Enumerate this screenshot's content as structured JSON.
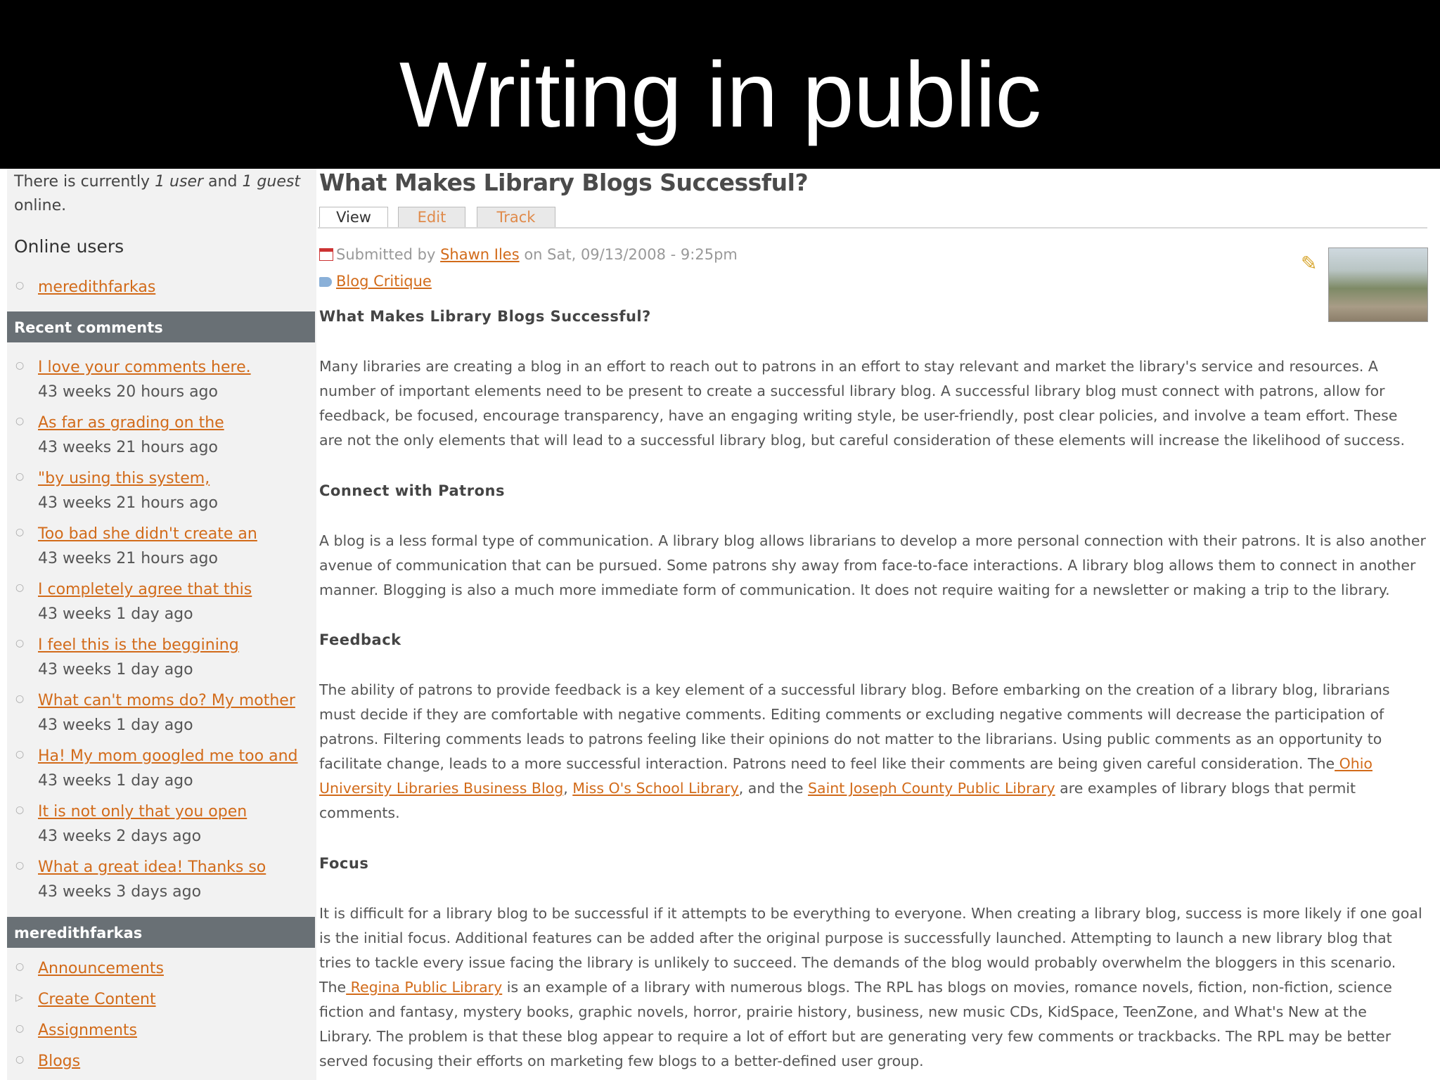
{
  "slide_title": "Writing in public",
  "sidebar": {
    "online_text_1": "There is currently ",
    "online_users_count": "1 user",
    "online_text_2": " and ",
    "online_guests_count": "1 guest",
    "online_text_3": "online.",
    "online_users_heading": "Online users",
    "online_users": [
      "meredithfarkas"
    ],
    "recent_comments_heading": "Recent comments",
    "recent_comments": [
      {
        "title": "I love your comments here.",
        "time": "43 weeks 20 hours ago"
      },
      {
        "title": "As far as grading on the",
        "time": "43 weeks 21 hours ago"
      },
      {
        "title": "\"by using this system,",
        "time": "43 weeks 21 hours ago"
      },
      {
        "title": "Too bad she didn't create an",
        "time": "43 weeks 21 hours ago"
      },
      {
        "title": "I completely agree that this",
        "time": "43 weeks 1 day ago"
      },
      {
        "title": "I feel this is the beggining",
        "time": "43 weeks 1 day ago"
      },
      {
        "title": "What can't moms do? My mother",
        "time": "43 weeks 1 day ago"
      },
      {
        "title": "Ha! My mom googled me too and",
        "time": "43 weeks 1 day ago"
      },
      {
        "title": "It is not only that you open",
        "time": "43 weeks 2 days ago"
      },
      {
        "title": "What a great idea! Thanks so",
        "time": "43 weeks 3 days ago"
      }
    ],
    "user_block_heading": "meredithfarkas",
    "user_menu": [
      "Announcements",
      "Create Content",
      "Assignments",
      "Blogs"
    ]
  },
  "article": {
    "title": "What Makes Library Blogs Successful?",
    "tabs": [
      "View",
      "Edit",
      "Track"
    ],
    "submitted_prefix": "Submitted by ",
    "author": "Shawn Iles",
    "submitted_date": " on Sat, 09/13/2008 - 9:25pm",
    "tag": "Blog Critique",
    "subtitle": "What Makes Library Blogs Successful?",
    "intro_lines": [
      "Many libraries are creating a blog in an effort to reach out to patrons in an effort to stay relevant and market the library's service and resources.  A",
      "number of important elements need to be present to create a successful library blog.  A successful library blog must connect with patrons, allow for",
      "feedback, be focused, encourage transparency, have an engaging writing style, be user-friendly, post clear policies, and involve a team effort.  These",
      "are not the only elements that will lead to a successful library blog, but careful consideration of these elements will increase the likelihood of success."
    ],
    "section1_heading": "Connect with Patrons",
    "section1_lines": [
      "A blog is a less formal type of communication.  A library blog allows librarians to develop a more personal connection with their patrons.  It is also another",
      "avenue of communication that can be pursued.  Some patrons shy away from face-to-face interactions.  A library blog allows them to connect in another",
      "manner.  Blogging is also a much more immediate form of communication.  It does not require waiting for a newsletter or making a trip to the library."
    ],
    "section2_heading": "Feedback",
    "section2_lines": [
      "The ability of patrons to provide feedback is a key element of a successful library blog.  Before embarking on the creation of a library blog, librarians",
      "must decide if they are comfortable with negative comments.  Editing comments or excluding negative comments will decrease the participation of",
      "patrons.  Filtering comments leads to patrons feeling like their opinions do not matter to the librarians.  Using public comments as an opportunity to"
    ],
    "section2_line4_text": "facilitate change, leads to a more successful interaction.  Patrons need to feel like their comments are being given careful consideration.  The",
    "section2_link1_part1": " Ohio",
    "section2_link1_part2": "University Libraries Business Blog",
    "section2_sep1": ", ",
    "section2_link2": "Miss O's School Library",
    "section2_sep2": ", and the ",
    "section2_link3": "Saint Joseph County Public Library",
    "section2_line5_tail": " are examples of library blogs that permit",
    "section2_line6": "comments.",
    "section3_heading": "Focus",
    "section3_lines_a": [
      "It is difficult for a library blog to be successful if it attempts to be everything to everyone.  When creating a library blog, success is more likely if one goal",
      "is the initial focus.  Additional features can be added after the original purpose is successfully launched.  Attempting to launch a new library blog that",
      "tries to tackle every issue facing the library is unlikely to succeed.  The demands of the blog would probably overwhelm the bloggers in this scenario."
    ],
    "section3_line4_pre": "The",
    "section3_link": " Regina Public Library",
    "section3_line4_post": " is an example of a library with numerous blogs.  The RPL has blogs on movies, romance novels, fiction, non-fiction, science",
    "section3_lines_b": [
      "fiction and fantasy, mystery books, graphic novels, horror, prairie history, business, new music CDs, KidSpace, TeenZone, and What's New at the",
      "Library.  The problem is that these blog appear to require a lot of effort but are generating very few comments or trackbacks.  The RPL may be better",
      "served focusing their efforts on marketing few blogs to a better-defined user group."
    ]
  },
  "colors": {
    "link": "#d26b1a",
    "block_header": "#697075",
    "title_bar": "#000000"
  },
  "icons": [
    "calendar-icon",
    "tag-icon",
    "pencil-icon",
    "bullet-icon"
  ]
}
